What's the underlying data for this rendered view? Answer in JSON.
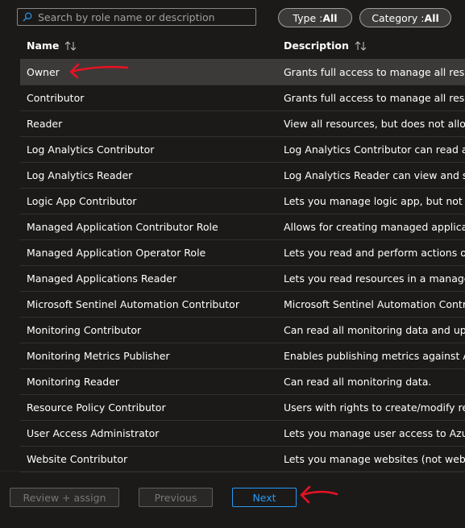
{
  "search": {
    "placeholder": "Search by role name or description",
    "value": ""
  },
  "filters": {
    "type": {
      "label": "Type : ",
      "value": "All"
    },
    "category": {
      "label": "Category : ",
      "value": "All"
    }
  },
  "table": {
    "columns": {
      "name": "Name",
      "description": "Description"
    },
    "selected_row": "Owner",
    "rows": [
      {
        "name": "Owner",
        "description": "Grants full access to manage all resources"
      },
      {
        "name": "Contributor",
        "description": "Grants full access to manage all resources"
      },
      {
        "name": "Reader",
        "description": "View all resources, but does not allow you"
      },
      {
        "name": "Log Analytics Contributor",
        "description": "Log Analytics Contributor can read all monitoring data"
      },
      {
        "name": "Log Analytics Reader",
        "description": "Log Analytics Reader can view and search"
      },
      {
        "name": "Logic App Contributor",
        "description": "Lets you manage logic app, but not access"
      },
      {
        "name": "Managed Application Contributor Role",
        "description": "Allows for creating managed application"
      },
      {
        "name": "Managed Application Operator Role",
        "description": "Lets you read and perform actions on Managed"
      },
      {
        "name": "Managed Applications Reader",
        "description": "Lets you read resources in a managed app"
      },
      {
        "name": "Microsoft Sentinel Automation Contributor",
        "description": "Microsoft Sentinel Automation Contributor"
      },
      {
        "name": "Monitoring Contributor",
        "description": "Can read all monitoring data and update"
      },
      {
        "name": "Monitoring Metrics Publisher",
        "description": "Enables publishing metrics against Azure"
      },
      {
        "name": "Monitoring Reader",
        "description": "Can read all monitoring data."
      },
      {
        "name": "Resource Policy Contributor",
        "description": "Users with rights to create/modify resource"
      },
      {
        "name": "User Access Administrator",
        "description": "Lets you manage user access to Azure resources"
      },
      {
        "name": "Website Contributor",
        "description": "Lets you manage websites (not web plans)"
      }
    ]
  },
  "footer": {
    "review_assign": "Review + assign",
    "previous": "Previous",
    "next": "Next"
  },
  "colors": {
    "background": "#1b1a19",
    "selected_row": "#3b3a39",
    "accent": "#2899f5",
    "annotation_arrow": "#e81123"
  },
  "icons": {
    "search": "search-icon",
    "sort": "sort-arrows-icon"
  }
}
